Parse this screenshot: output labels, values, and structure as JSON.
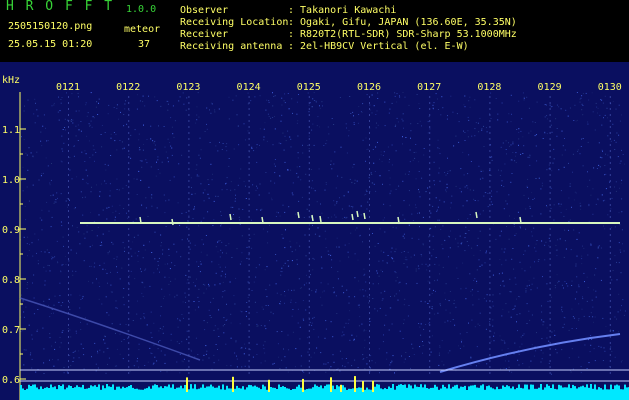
{
  "header": {
    "app_name": "H R O F F T",
    "version": "1.0.0",
    "file_name": "2505150120.png",
    "datetime": "25.05.15 01:20",
    "meteor_label": "meteor",
    "meteor_count": "37",
    "info": [
      {
        "key": "Observer",
        "value": ": Takanori Kawachi"
      },
      {
        "key": "Receiving Location",
        "value": ": Ogaki, Gifu, JAPAN (136.60E, 35.35N)"
      },
      {
        "key": "Receiver",
        "value": ": R820T2(RTL-SDR) SDR-Sharp 53.1000MHz"
      },
      {
        "key": "Receiving antenna",
        "value": ": 2el-HB9CV Vertical (el. E-W)"
      }
    ]
  },
  "spectrogram": {
    "y_unit": "kHz",
    "time_labels": [
      "0121",
      "0122",
      "0123",
      "0124",
      "0125",
      "0126",
      "0127",
      "0128",
      "0129",
      "0130"
    ],
    "freq_labels": [
      "1.1",
      "1.0",
      "0.9",
      "0.8",
      "0.7",
      "0.6"
    ],
    "colors": {
      "background": "#0a0f60",
      "carrier": "#d8f8c0",
      "baseline": "#00e8ff",
      "meteor": "#ffff40"
    }
  }
}
